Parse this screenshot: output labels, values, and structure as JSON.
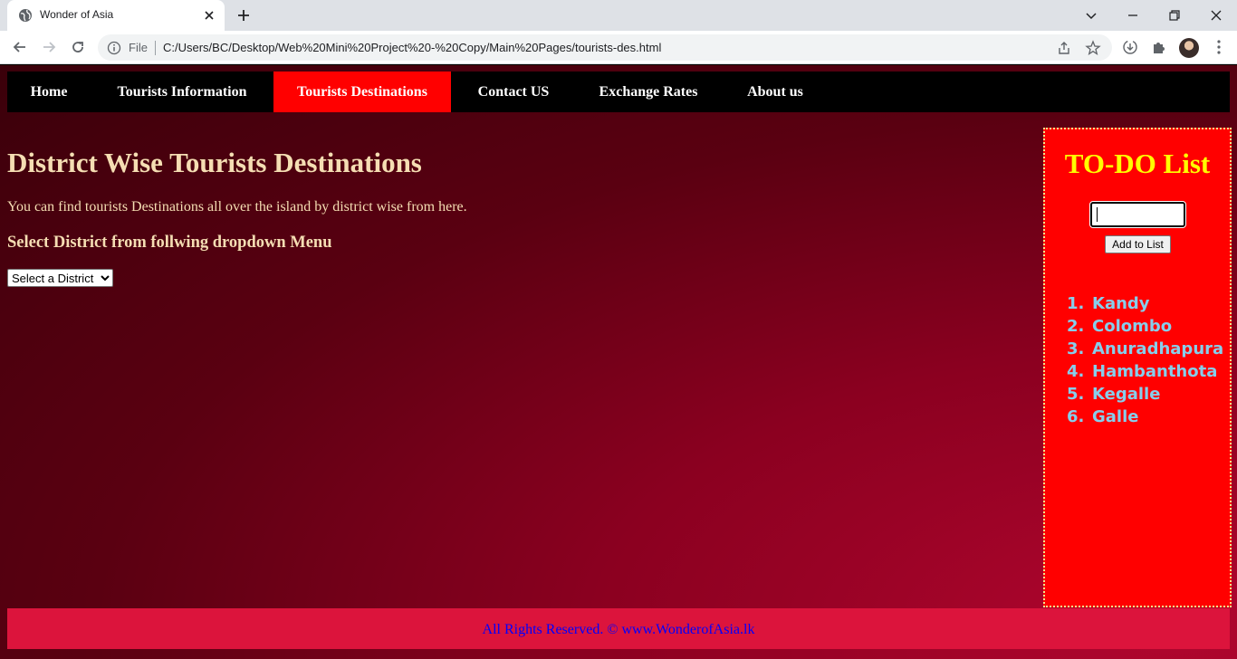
{
  "browser": {
    "tab_title": "Wonder of Asia",
    "omnibox": {
      "scheme_label": "File",
      "url": "C:/Users/BC/Desktop/Web%20Mini%20Project%20-%20Copy/Main%20Pages/tourists-des.html"
    }
  },
  "nav": {
    "items": [
      {
        "label": "Home",
        "active": false
      },
      {
        "label": "Tourists Information",
        "active": false
      },
      {
        "label": "Tourists Destinations",
        "active": true
      },
      {
        "label": "Contact US",
        "active": false
      },
      {
        "label": "Exchange Rates",
        "active": false
      },
      {
        "label": "About us",
        "active": false
      }
    ]
  },
  "main": {
    "heading": "District Wise Tourists Destinations",
    "intro": "You can find tourists Destinations all over the island by district wise from here.",
    "subheading": "Select District from follwing dropdown Menu",
    "select_value": "Select a District"
  },
  "todo": {
    "title": "TO-DO List",
    "input_value": "",
    "add_button": "Add to List",
    "items": [
      "Kandy",
      "Colombo",
      "Anuradhapura",
      "Hambanthota",
      "Kegalle",
      "Galle"
    ]
  },
  "footer": {
    "text": "All Rights Reserved. © www.WonderofAsia.lk"
  },
  "colors": {
    "nav_active": "#ff0000",
    "heading_text": "#f5deb3",
    "todo_bg": "#ff0000",
    "todo_title": "#ffff00",
    "todo_items": "#87ceeb",
    "footer_bg": "#dc143c",
    "footer_text": "#0000ff"
  }
}
